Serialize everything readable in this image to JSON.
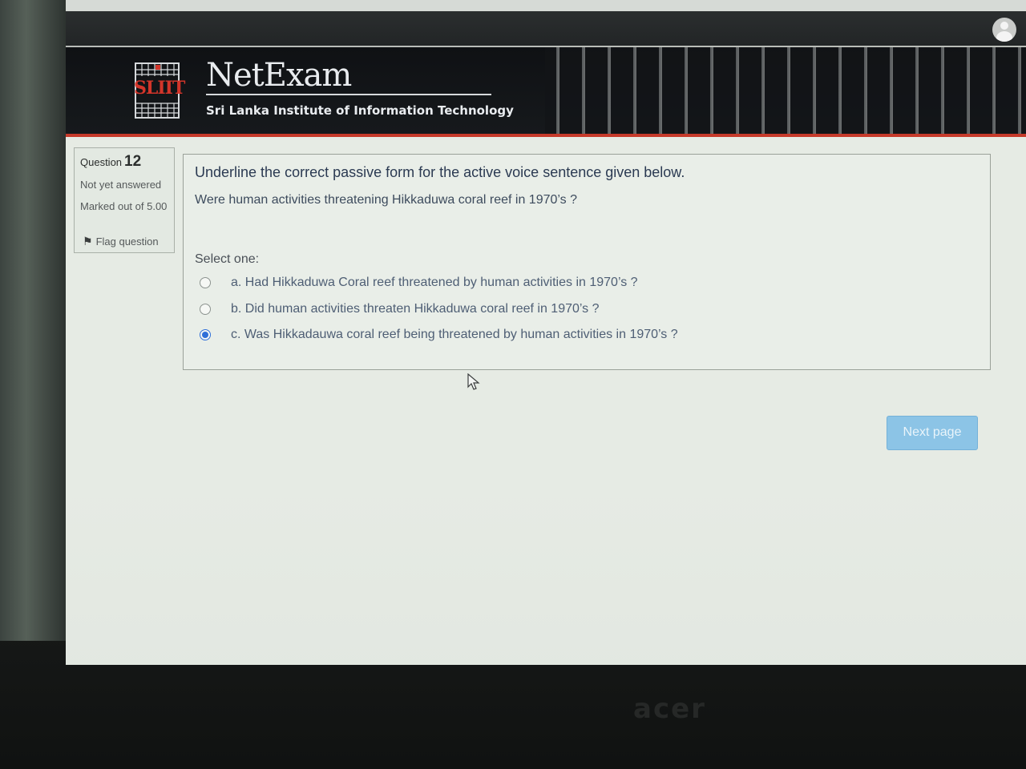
{
  "header": {
    "logo_text": "SLIIT",
    "app_title": "NetExam",
    "subtitle": "Sri Lanka Institute of Information Technology"
  },
  "question_info": {
    "question_label": "Question",
    "question_number": "12",
    "state": "Not yet answered",
    "marked": "Marked out of 5.00",
    "flag_label": "Flag question"
  },
  "question": {
    "prompt": "Underline the correct passive form for the active voice sentence given below.",
    "sentence": "Were human activities threatening Hikkaduwa coral reef in 1970’s ?",
    "select_label": "Select one:",
    "options": [
      {
        "label": "a. Had Hikkaduwa Coral reef threatened by human activities in 1970’s ?",
        "selected": false
      },
      {
        "label": "b. Did human activities threaten Hikkaduwa coral reef in 1970’s ?",
        "selected": false
      },
      {
        "label": "c. Was Hikkadauwa coral reef being threatened by human activities in 1970’s ?",
        "selected": true
      }
    ]
  },
  "navigation": {
    "next_label": "Next page"
  },
  "monitor": {
    "brand": "acer"
  },
  "colors": {
    "header_bg": "#15181b",
    "accent_red": "#c63a2a",
    "radio_selected": "#2f6fd8",
    "next_button": "#8cc4e6"
  }
}
